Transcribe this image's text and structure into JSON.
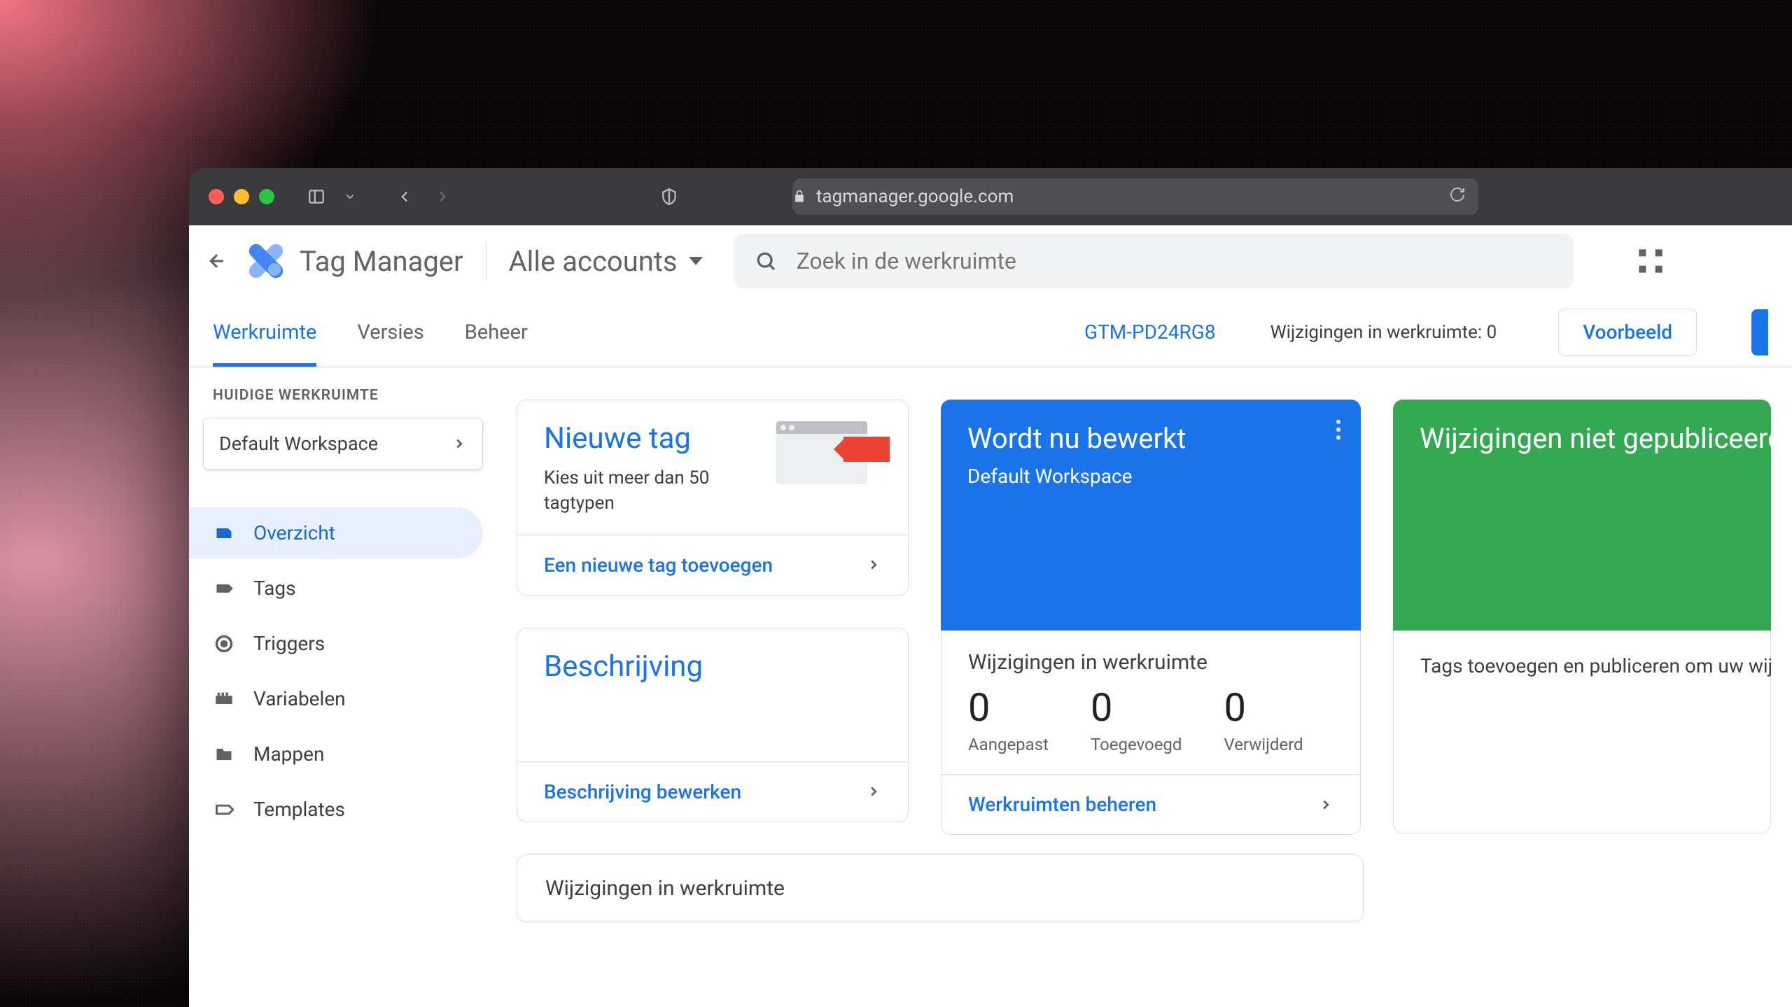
{
  "browser": {
    "url_host": "tagmanager.google.com"
  },
  "header": {
    "app_name": "Tag Manager",
    "account_selector": "Alle accounts",
    "search_placeholder": "Zoek in de werkruimte"
  },
  "tabs": {
    "workspace": "Werkruimte",
    "versions": "Versies",
    "admin": "Beheer",
    "container_id": "GTM-PD24RG8",
    "changes_label": "Wijzigingen in werkruimte: 0",
    "preview_btn": "Voorbeeld"
  },
  "sidebar": {
    "current_label": "HUIDIGE WERKRUIMTE",
    "workspace_name": "Default Workspace",
    "items": [
      {
        "label": "Overzicht",
        "icon": "overview"
      },
      {
        "label": "Tags",
        "icon": "tag"
      },
      {
        "label": "Triggers",
        "icon": "trigger"
      },
      {
        "label": "Variabelen",
        "icon": "variable"
      },
      {
        "label": "Mappen",
        "icon": "folder"
      },
      {
        "label": "Templates",
        "icon": "template"
      }
    ]
  },
  "cards": {
    "new_tag": {
      "title": "Nieuwe tag",
      "subtitle": "Kies uit meer dan 50 tagtypen",
      "action": "Een nieuwe tag toevoegen"
    },
    "description": {
      "title": "Beschrijving",
      "action": "Beschrijving bewerken"
    },
    "editing": {
      "title": "Wordt nu bewerkt",
      "subtitle": "Default Workspace"
    },
    "stats": {
      "title": "Wijzigingen in werkruimte",
      "items": [
        {
          "value": "0",
          "label": "Aangepast"
        },
        {
          "value": "0",
          "label": "Toegevoegd"
        },
        {
          "value": "0",
          "label": "Verwijderd"
        }
      ],
      "action": "Werkruimten beheren"
    },
    "unpublished": {
      "title": "Wijzigingen niet gepubliceerd",
      "body": "Tags toevoegen en publiceren om uw wijzigingen door te voeren."
    },
    "changes_wide": {
      "title": "Wijzigingen in werkruimte"
    }
  }
}
